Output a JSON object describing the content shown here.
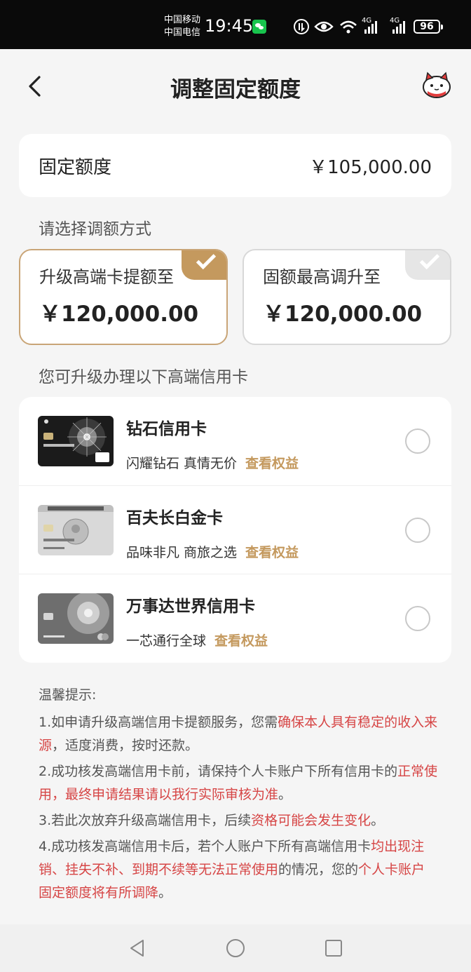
{
  "status_bar": {
    "carrier1": "中国移动",
    "carrier2": "中国电信",
    "time": "19:45",
    "network1": "4G",
    "network2": "4G",
    "battery": "96"
  },
  "header": {
    "title": "调整固定额度"
  },
  "quota": {
    "label": "固定额度",
    "value": "￥105,000.00"
  },
  "choose_label": "请选择调额方式",
  "options": [
    {
      "title": "升级高端卡提额至",
      "value": "￥120,000.00",
      "selected": true
    },
    {
      "title": "固额最高调升至",
      "value": "￥120,000.00",
      "selected": false
    }
  ],
  "upgrade_label": "您可升级办理以下高端信用卡",
  "cards": [
    {
      "name": "钻石信用卡",
      "desc": "闪耀钻石 真情无价",
      "link": "查看权益"
    },
    {
      "name": "百夫长白金卡",
      "desc": "品味非凡 商旅之选",
      "link": "查看权益"
    },
    {
      "name": "万事达世界信用卡",
      "desc": "一芯通行全球",
      "link": "查看权益"
    }
  ],
  "tips": {
    "title": "温馨提示:",
    "items": [
      {
        "a": "1.如申请升级高端信用卡提额服务，您需",
        "b": "确保本人具有稳定的收入来源",
        "c": "，适度消费，按时还款。"
      },
      {
        "a": "2.成功核发高端信用卡前，请保持个人卡账户下所有信用卡的",
        "b": "正常使用，最终申请结果请以我行实际审核为准",
        "c": "。"
      },
      {
        "a": "3.若此次放弃升级高端信用卡，后续",
        "b": "资格可能会发生变化",
        "c": "。"
      },
      {
        "a": "4.成功核发高端信用卡后，若个人账户下所有高端信用卡",
        "b": "均出现注销、挂失不补、到期不续等无法正常使用",
        "c": "的情况，您的",
        "d": "个人卡账户固定额度将有所调降",
        "e": "。"
      }
    ]
  },
  "colors": {
    "accent": "#c4995e",
    "warning": "#d64545"
  }
}
